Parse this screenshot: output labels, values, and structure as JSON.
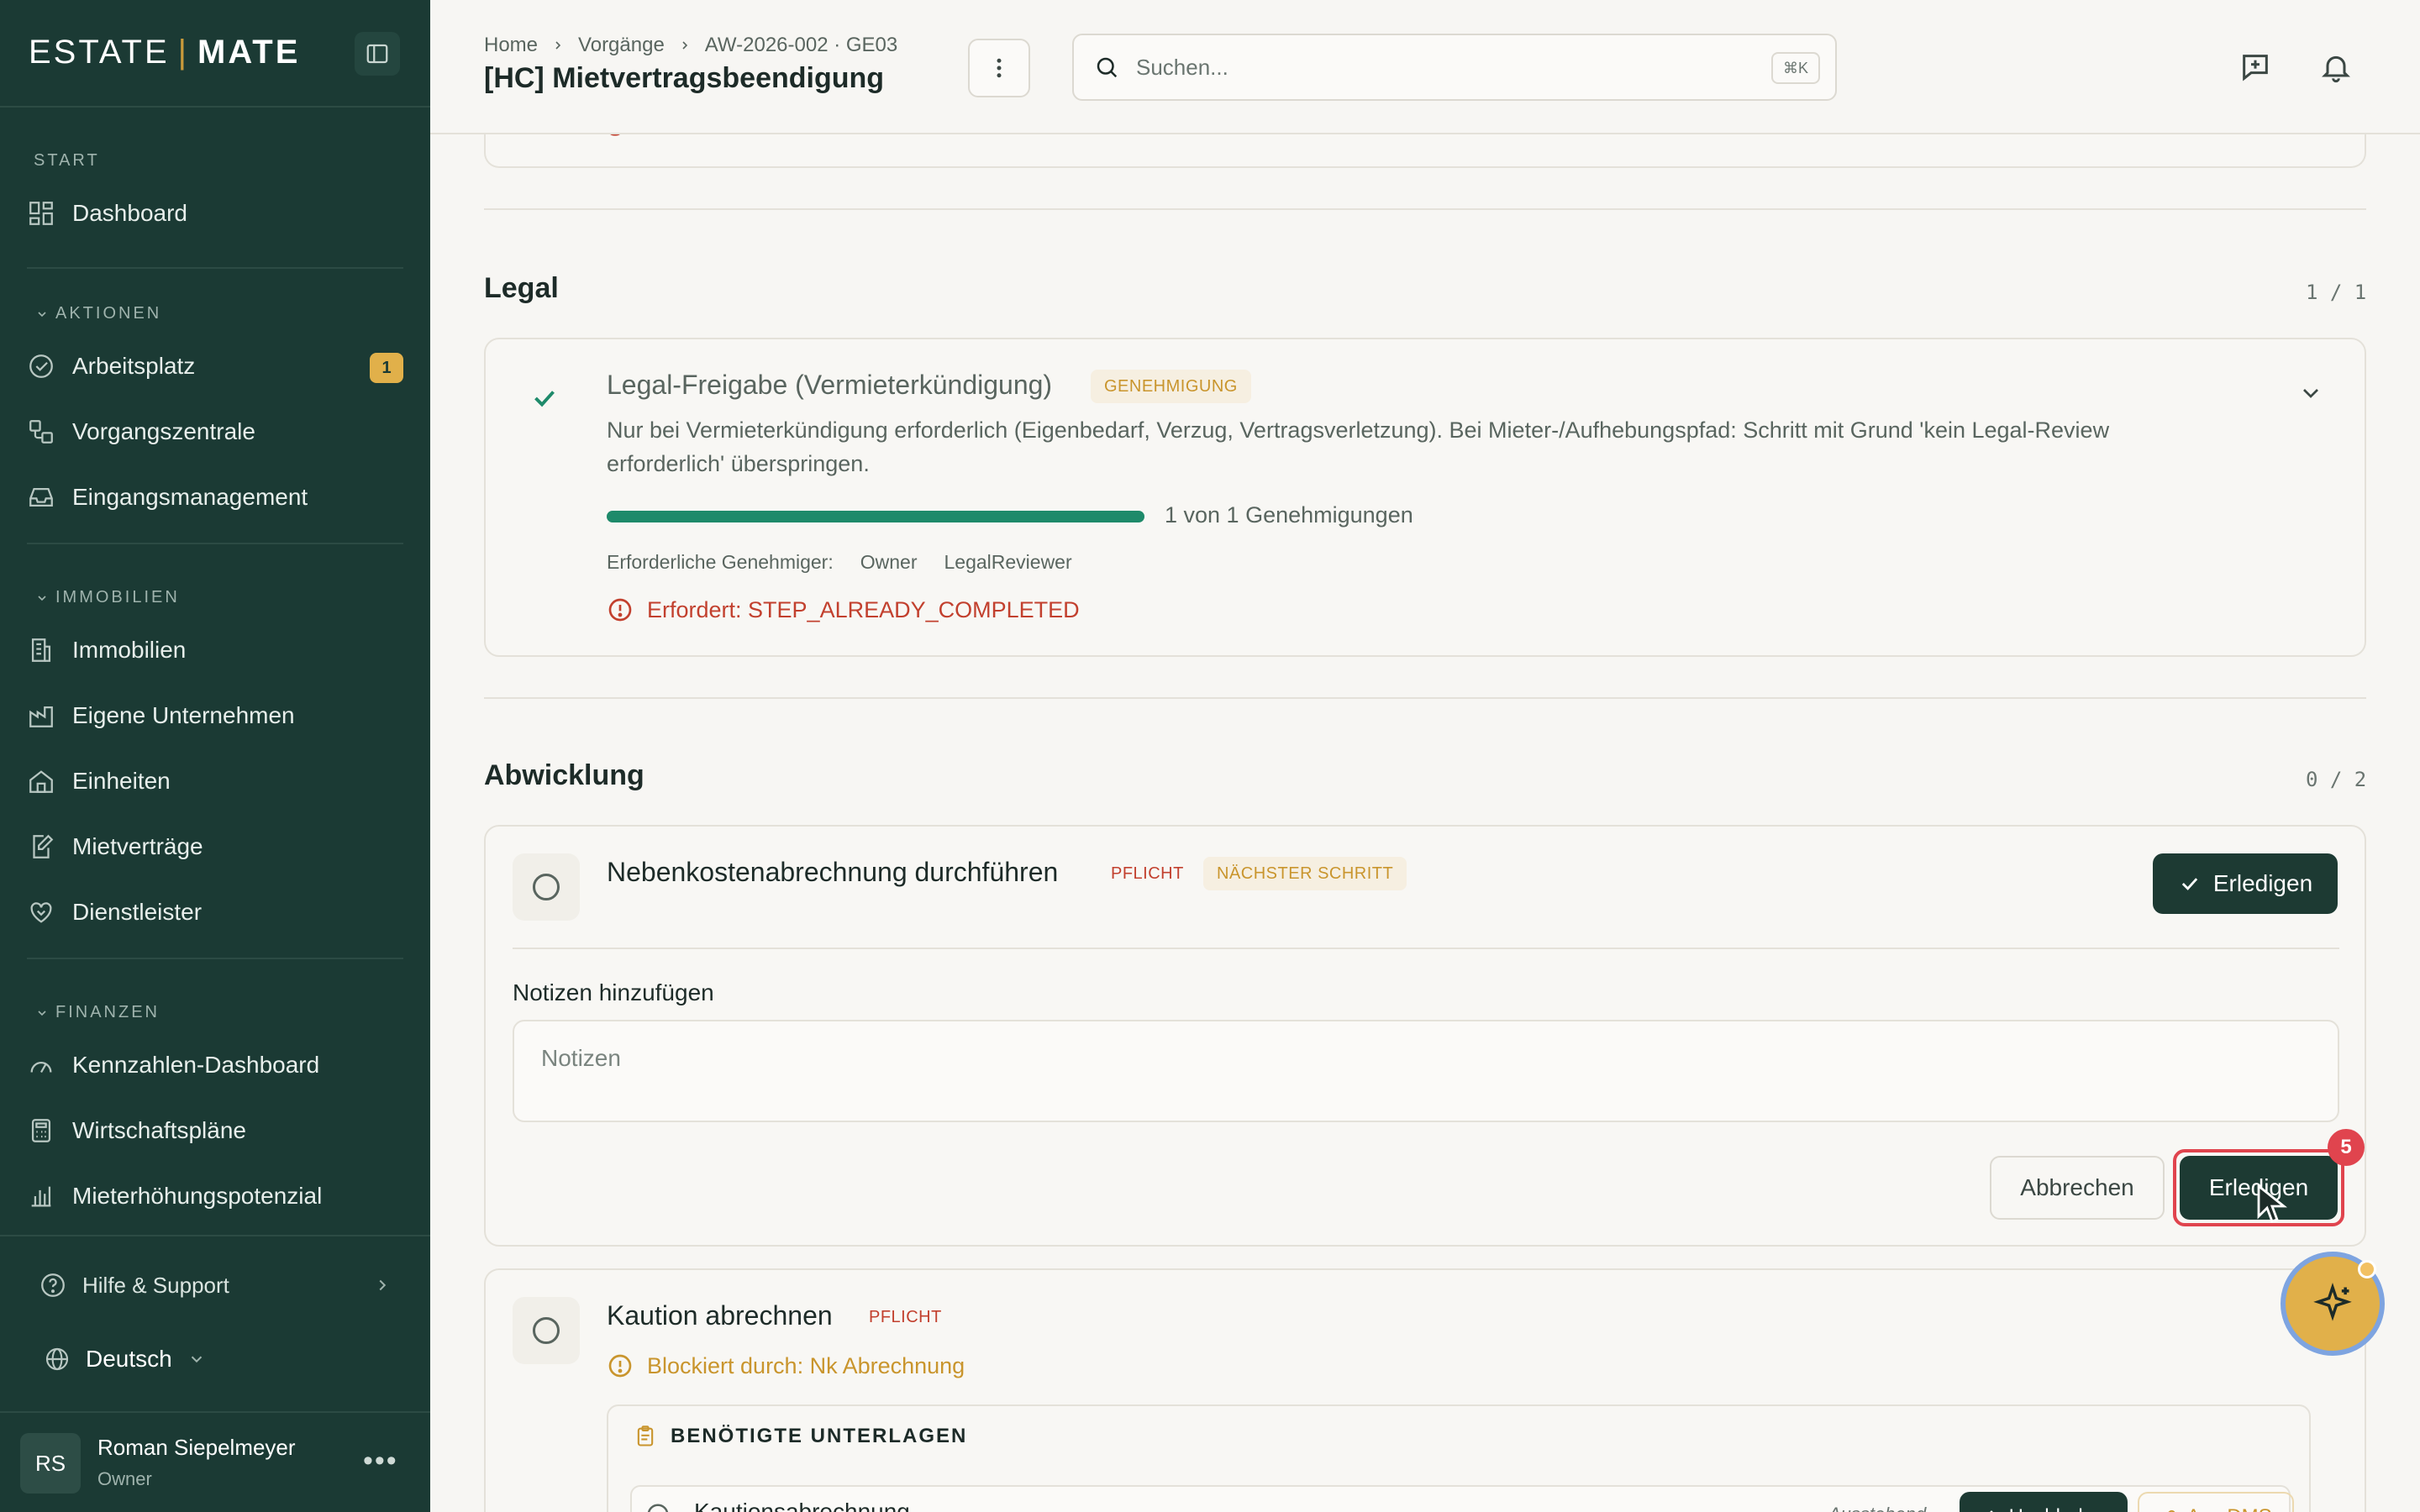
{
  "app": {
    "brand_left": "ESTATE",
    "brand_sep": "|",
    "brand_right": "MATE",
    "accent": "#c99a3b",
    "sidebar_bg": "#1b3a34"
  },
  "sidebar": {
    "start_label": "START",
    "dashboard": "Dashboard",
    "aktionen_label": "AKTIONEN",
    "arbeitsplatz": "Arbeitsplatz",
    "arbeitsplatz_count": "1",
    "vorgangszentrale": "Vorgangszentrale",
    "eingangsmanagement": "Eingangsmanagement",
    "immobilien_label": "IMMOBILIEN",
    "immobilien": "Immobilien",
    "eigene_unternehmen": "Eigene Unternehmen",
    "einheiten": "Einheiten",
    "mietvertraege": "Mietverträge",
    "dienstleister": "Dienstleister",
    "finanzen_label": "FINANZEN",
    "kennzahlen": "Kennzahlen-Dashboard",
    "wirtschaftsplaene": "Wirtschaftspläne",
    "mieterhoehung": "Mieterhöhungspotenzial",
    "help": "Hilfe & Support",
    "language": "Deutsch",
    "user_initials": "RS",
    "user_name": "Roman Siepelmeyer",
    "user_role": "Owner"
  },
  "header": {
    "crumb_home": "Home",
    "crumb_vorgaenge": "Vorgänge",
    "crumb_id": "AW-2026-002 · GE03",
    "title": "[HC] Mietvertragsbeendigung",
    "search_placeholder": "Suchen...",
    "search_shortcut": "⌘K"
  },
  "legal": {
    "title": "Legal",
    "count": "1 / 1",
    "step_title": "Legal-Freigabe (Vermieterkündigung)",
    "step_badge": "GENEHMIGUNG",
    "description_line1": "Nur bei Vermieterkündigung erforderlich (Eigenbedarf, Verzug, Vertragsverletzung). Bei Mieter-/Aufhebungspfad: Schritt mit Grund 'kein Legal-Review",
    "description_line2": "erforderlich' überspringen.",
    "progress_fraction": 1.0,
    "progress_text": "1 von 1 Genehmigungen",
    "approvers_label": "Erforderliche Genehmiger:",
    "approver_1": "Owner",
    "approver_2": "LegalReviewer",
    "error_text": "Erfordert: STEP_ALREADY_COMPLETED"
  },
  "abwicklung": {
    "title": "Abwicklung",
    "count": "0 / 2",
    "step1_title": "Nebenkostenabrechnung durchführen",
    "step1_badge_required": "PFLICHT",
    "step1_badge_next": "NÄCHSTER SCHRITT",
    "step1_complete_btn": "Erledigen",
    "notes_label": "Notizen hinzufügen",
    "notes_placeholder": "Notizen",
    "cancel_btn": "Abbrechen",
    "confirm_btn": "Erledigen",
    "notification_count": "5",
    "step2_title": "Kaution abrechnen",
    "step2_badge_required": "PFLICHT",
    "step2_blocked": "Blockiert durch: Nk Abrechnung",
    "docs_header": "BENÖTIGTE UNTERLAGEN",
    "doc_row_name": "Kautionsabrechnung",
    "doc_row_status": "Ausstehend",
    "doc_upload_btn": "Hochladen",
    "doc_dms_btn": "Aus DMS"
  }
}
